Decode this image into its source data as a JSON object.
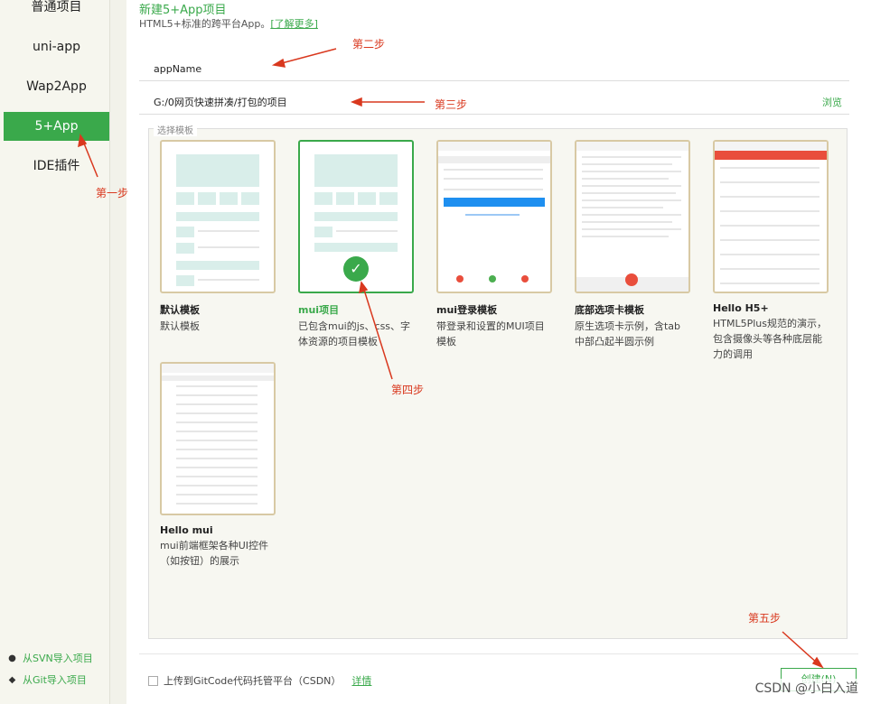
{
  "sidebar": {
    "items": [
      {
        "label": "普通项目"
      },
      {
        "label": "uni-app"
      },
      {
        "label": "Wap2App"
      },
      {
        "label": "5+App"
      },
      {
        "label": "IDE插件"
      }
    ],
    "svn_import": "从SVN导入项目",
    "git_import": "从Git导入项目"
  },
  "header": {
    "title": "新建5+App项目",
    "subtitle": "HTML5+标准的跨平台App。",
    "learn_more": "[了解更多]"
  },
  "form": {
    "app_name": "appName",
    "path": "G:/0网页快速拼凑/打包的项目",
    "browse": "浏览"
  },
  "templates": {
    "legend": "选择模板",
    "items": [
      {
        "name": "默认模板",
        "desc": "默认模板"
      },
      {
        "name": "mui项目",
        "desc": "已包含mui的js、css、字体资源的项目模板",
        "selected": true
      },
      {
        "name": "mui登录模板",
        "desc": "带登录和设置的MUI项目模板"
      },
      {
        "name": "底部选项卡模板",
        "desc": "原生选项卡示例，含tab中部凸起半圆示例"
      },
      {
        "name": "Hello H5+",
        "desc": "HTML5Plus规范的演示，包含摄像头等各种底层能力的调用"
      },
      {
        "name": "Hello mui",
        "desc": "mui前端框架各种UI控件（如按钮）的展示"
      }
    ]
  },
  "footer": {
    "upload_label": "上传到GitCode代码托管平台（CSDN）",
    "details": "详情",
    "create": "创建(N)"
  },
  "annotations": {
    "step1": "第一步",
    "step2": "第二步",
    "step3": "第三步",
    "step4": "第四步",
    "step5": "第五步"
  },
  "watermark": "CSDN @小白入道",
  "colors": {
    "accent": "#3aa94b",
    "annotation": "#d9381e",
    "card_border": "#d8c9a4"
  }
}
